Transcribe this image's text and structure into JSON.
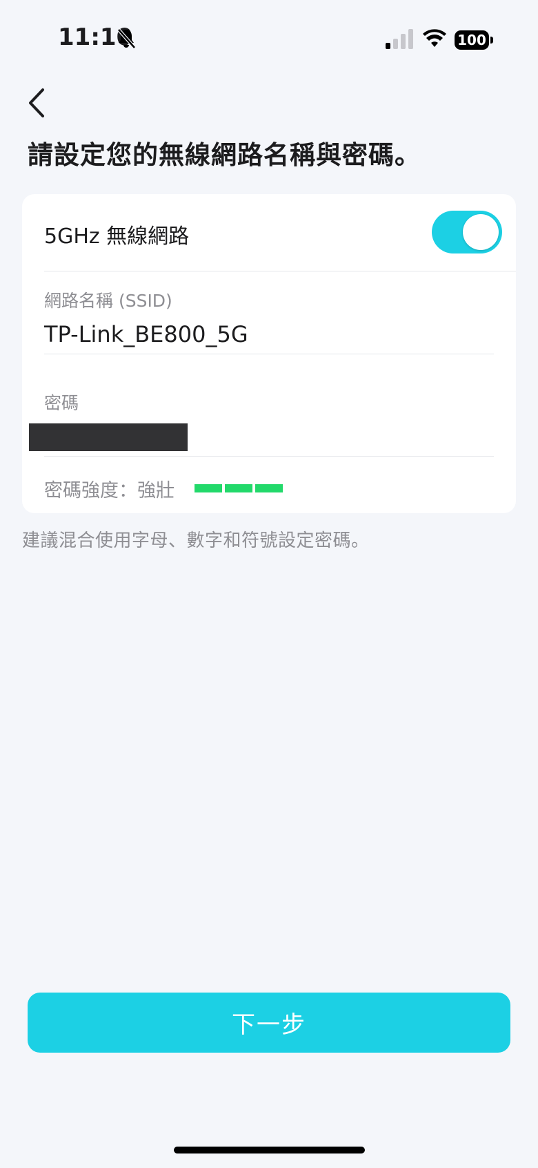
{
  "status_bar": {
    "time": "11:10",
    "battery": "100",
    "icons": [
      "bell-slash-icon",
      "cellular-signal-icon",
      "wifi-icon",
      "battery-icon"
    ]
  },
  "header": {
    "back_icon": "chevron-left-icon",
    "title": "請設定您的無線網路名稱與密碼。"
  },
  "wifi_card": {
    "band_label": "5GHz 無線網路",
    "band_enabled": true,
    "ssid_label": "網路名稱 (SSID)",
    "ssid_value": "TP-Link_BE800_5G",
    "password_label": "密碼",
    "strength_label": "密碼強度：強壯",
    "strength_level": 3,
    "strength_max": 3
  },
  "hint": "建議混合使用字母、數字和符號設定密碼。",
  "footer": {
    "next_label": "下一步"
  },
  "colors": {
    "accent": "#1cd0e4",
    "strength_strong": "#22d96a",
    "background": "#f4f6fa",
    "card": "#ffffff",
    "muted_text": "#8e8e93"
  }
}
